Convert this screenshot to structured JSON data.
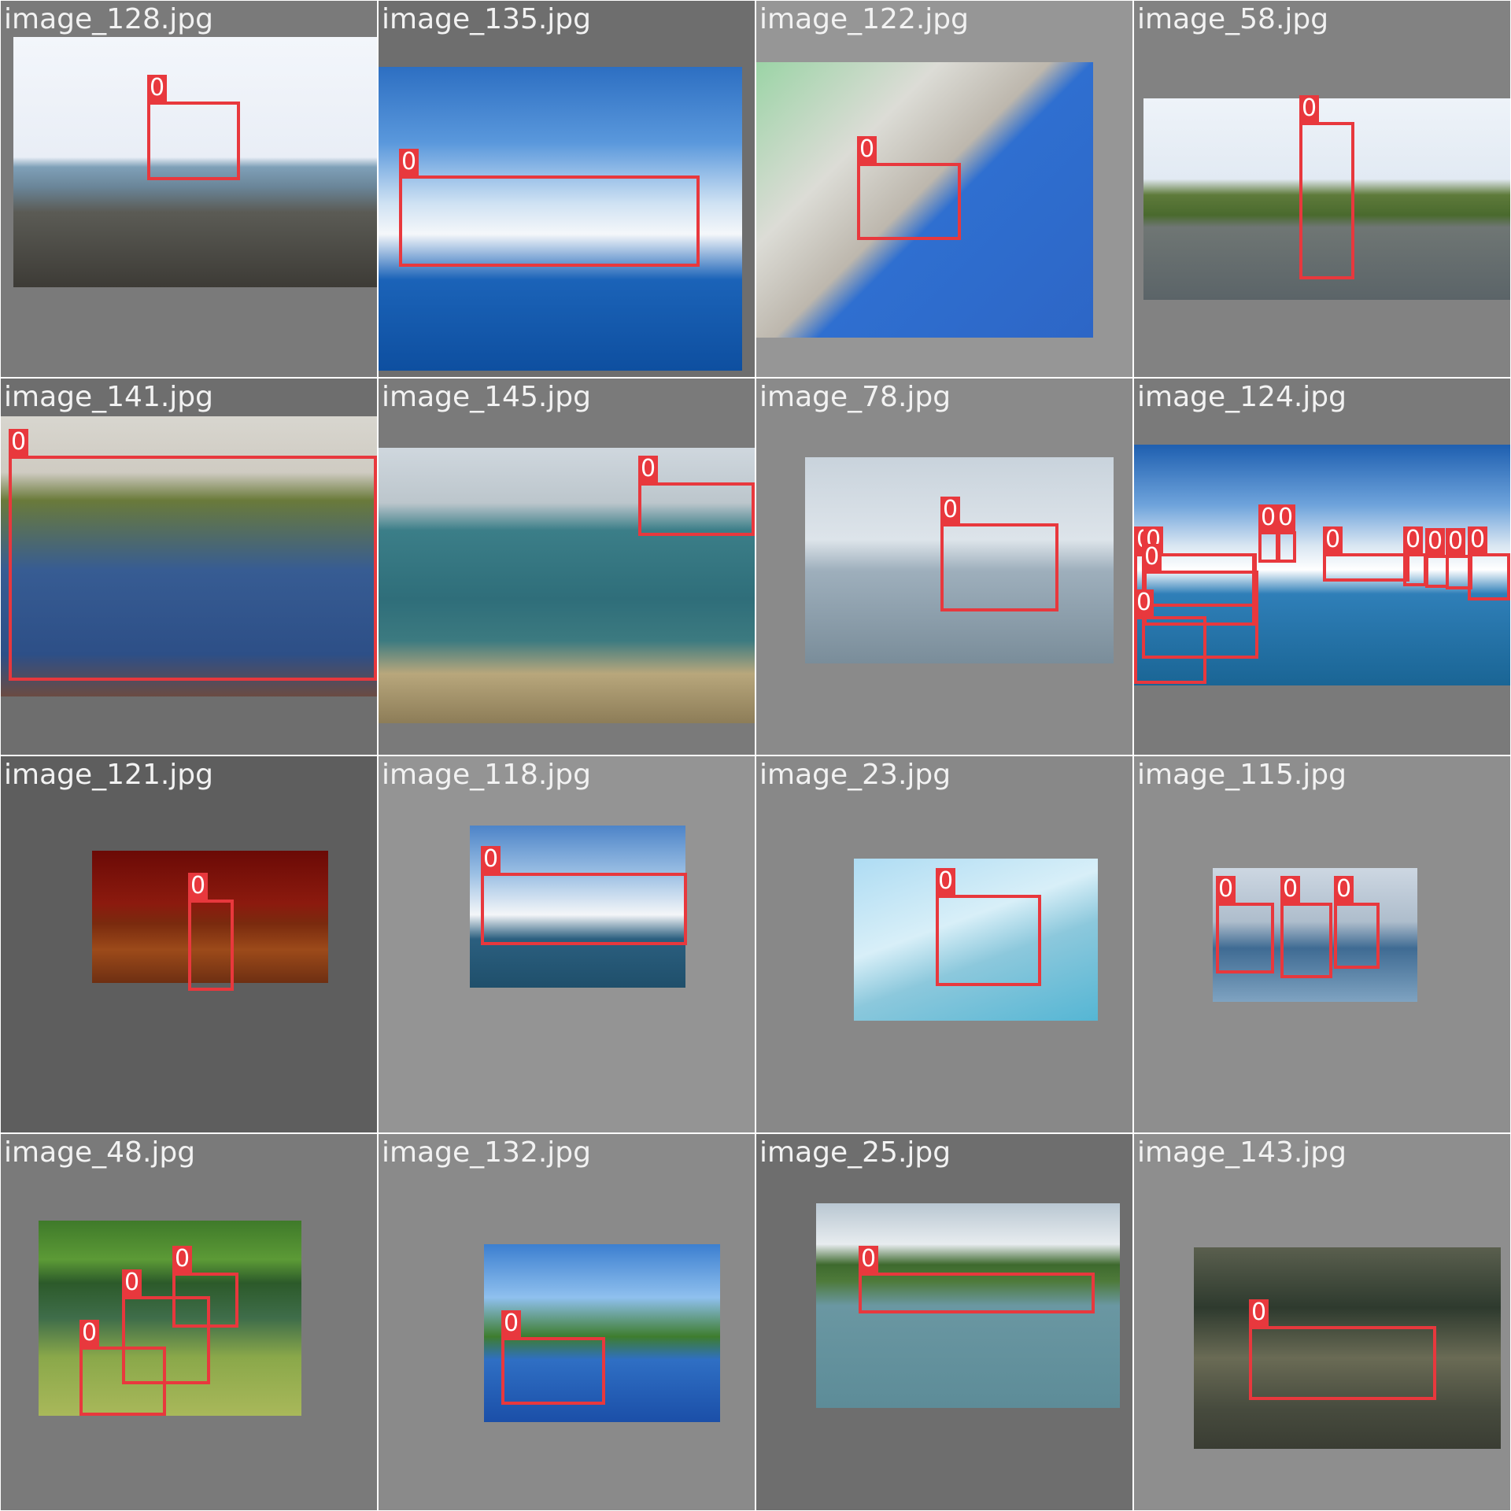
{
  "mosaic": {
    "cells": [
      {
        "title": "image_128.jpg",
        "labels": [
          "0"
        ]
      },
      {
        "title": "image_135.jpg",
        "labels": [
          "0"
        ]
      },
      {
        "title": "image_122.jpg",
        "labels": [
          "0"
        ]
      },
      {
        "title": "image_58.jpg",
        "labels": [
          "0"
        ]
      },
      {
        "title": "image_141.jpg",
        "labels": [
          "0"
        ]
      },
      {
        "title": "image_145.jpg",
        "labels": [
          "0"
        ]
      },
      {
        "title": "image_78.jpg",
        "labels": [
          "0"
        ]
      },
      {
        "title": "image_124.jpg",
        "labels": [
          "0",
          "0",
          "0",
          "0",
          "0",
          "0",
          "0",
          "0",
          "0",
          "0",
          "0"
        ]
      },
      {
        "title": "image_121.jpg",
        "labels": [
          "0"
        ]
      },
      {
        "title": "image_118.jpg",
        "labels": [
          "0"
        ]
      },
      {
        "title": "image_23.jpg",
        "labels": [
          "0"
        ]
      },
      {
        "title": "image_115.jpg",
        "labels": [
          "0",
          "0",
          "0"
        ]
      },
      {
        "title": "image_48.jpg",
        "labels": [
          "0",
          "0",
          "0"
        ]
      },
      {
        "title": "image_132.jpg",
        "labels": [
          "0"
        ]
      },
      {
        "title": "image_25.jpg",
        "labels": [
          "0"
        ]
      },
      {
        "title": "image_143.jpg",
        "labels": [
          "0"
        ]
      }
    ],
    "box_color": "#e8383d"
  }
}
